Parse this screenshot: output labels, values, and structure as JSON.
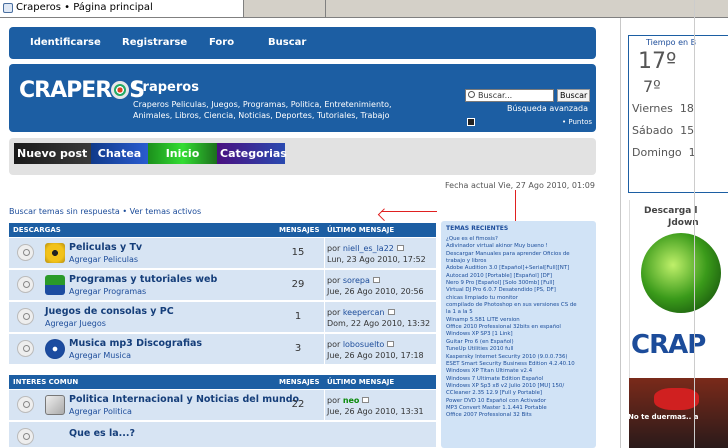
{
  "browser": {
    "tab_title": "Craperos • Página principal"
  },
  "nav": {
    "login": "Identificarse",
    "register": "Registrarse",
    "forum": "Foro",
    "search": "Buscar"
  },
  "header": {
    "logo_text": "CRAPER",
    "logo_tail": "S",
    "title": "Craperos",
    "description": "Craperos Peliculas, Juegos, Programas, Politica, Entretenimiento, Animales, Libros, Ciencia, Noticias, Deportes, Tutoriales, Trabajo",
    "search_placeholder": "Buscar...",
    "search_button": "Buscar",
    "advanced_search": "Búsqueda avanzada",
    "puntos": "• Puntos"
  },
  "banners": {
    "b1": "Nuevo post",
    "b2": "Chatea",
    "b3": "Inicio",
    "b4": "Categorias"
  },
  "datetime": "Fecha actual Vie, 27 Ago 2010, 01:09",
  "quicklinks": {
    "unanswered": "Buscar temas sin respuesta",
    "sep": " • ",
    "active": "Ver temas activos"
  },
  "sections": [
    {
      "title": "DESCARGAS",
      "col_posts": "MENSAJES",
      "col_last": "ÚLTIMO MENSAJE",
      "forums": [
        {
          "name": "Peliculas y Tv",
          "add": "Agregar Peliculas",
          "count": "15",
          "last_user": "niell_es_la22",
          "last_date": "Lun, 23 Ago 2010, 17:52",
          "icon": "radiation-icon"
        },
        {
          "name": "Programas y tutoriales web",
          "add": "Agregar Programas",
          "count": "29",
          "last_user": "sorepa",
          "last_date": "Jue, 26 Ago 2010, 20:56",
          "icon": "download-disk-icon"
        },
        {
          "name": "Juegos de consolas y PC",
          "add": "Agregar Juegos",
          "count": "1",
          "last_user": "keepercan",
          "last_date": "Dom, 22 Ago 2010, 13:32",
          "icon": "none"
        },
        {
          "name": "Musica mp3 Discografias",
          "add": "Agregar Musica",
          "count": "3",
          "last_user": "lobosuelto",
          "last_date": "Jue, 26 Ago 2010, 17:18",
          "icon": "media-player-icon"
        }
      ]
    },
    {
      "title": "INTERES COMUN",
      "col_posts": "MENSAJES",
      "col_last": "ÚLTIMO MENSAJE",
      "forums": [
        {
          "name": "Politica Internacional y Noticias del mundo",
          "add": "Agregar Politica",
          "count": "22",
          "last_user": "neo",
          "last_date": "Jue, 26 Ago 2010, 13:31",
          "icon": "newspaper-icon"
        },
        {
          "name": "Que es la...?",
          "add": "",
          "count": "",
          "last_user": "",
          "last_date": "",
          "icon": "partial"
        }
      ]
    }
  ],
  "recent": {
    "title": "TEMAS RECIENTES",
    "items": [
      "¿Que es el fimosis?",
      "Adivinador virtual akinor Muy bueno !",
      "Descargar Manuales para aprender Oficios de",
      "trabajo y libros",
      "Adobe Audition 3.0 [Español]+Serial[Full][NT]",
      "Autocad 2010 [Portable] [Español] [DF]",
      "Nero 9 Pro [Español] [Solo 300mb] [Full]",
      "Virtual DJ Pro 6.0.7 Desatendido [PS, DF]",
      "chicas limpiado tu monitor",
      "compilado de Photoshop en sus versiones CS de",
      "la 1 a la 5",
      "Winamp 5.581 LITE version",
      "Office 2010 Professional 32bits en español",
      "Windows XP SP3 [1 Link]",
      "Guitar Pro 6 (en Español)",
      "TuneUp Utilities 2010 full",
      "Kaspersky Internet Security 2010 (9.0.0.736)",
      "ESET Smart Security Business Edition 4.2.40.10",
      "Windows XP Titan Ultimate v2.4",
      "Windows 7 Ultimate Edition Español",
      "Windows XP Sp3 x8 v2 Julio 2010 [MU] 150/",
      "CCleaner 2.35 12.9 [Full y Portable]",
      "Power DVD 10 Español con Activador",
      "MP3 Convert Master 1.1.441 Portable",
      "Office 2007 Professional 32 Bits"
    ]
  },
  "sidebar": {
    "weather_title": "Tiempo en B",
    "temp_high": "17º",
    "temp_low": "7º",
    "days": [
      {
        "day": "Viernes",
        "temp": "18"
      },
      {
        "day": "Sábado",
        "temp": "15"
      },
      {
        "day": "Domingo",
        "temp": "1"
      }
    ],
    "download_line1": "Descarga l",
    "download_line2": "Jdown",
    "side_logo": "CRAP",
    "ad_text": "No te duermas.. a"
  }
}
